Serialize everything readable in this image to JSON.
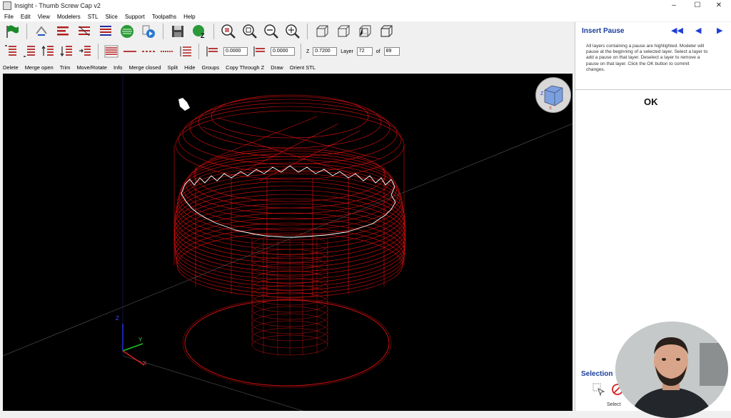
{
  "window": {
    "title": "Insight - Thumb Screw Cap v2"
  },
  "window_controls": {
    "minimize": "–",
    "maximize": "☐",
    "close": "✕"
  },
  "menu": [
    "File",
    "Edit",
    "View",
    "Modelers",
    "STL",
    "Slice",
    "Support",
    "Toolpaths",
    "Help"
  ],
  "toolbar2": {
    "field1": "0.0000",
    "field2": "0.0000",
    "z_label": "Z",
    "z_value": "0.7200",
    "layer_label": "Layer",
    "layer_value": "72",
    "of_label": "of",
    "layer_total": "89"
  },
  "toolbar3": [
    "Delete",
    "Merge open",
    "Trim",
    "Move/Rotate",
    "Info",
    "Merge closed",
    "Split",
    "Hide",
    "Groups",
    "Copy Through Z",
    "Draw",
    "Orient STL"
  ],
  "axes": {
    "z": "Z",
    "y": "Y",
    "x": "X"
  },
  "panel": {
    "title": "Insert Pause",
    "nav_first": "◀◀",
    "nav_prev": "◀",
    "nav_next": "▶",
    "description": "All layers containing a pause are highlighted. Modeler will pause at the beginning of a selected layer. Select a layer to add a pause on that layer. Deselect a layer to remove a pause on that layer. Click the OK button to commit changes.",
    "ok_label": "OK",
    "selection_title": "Selection",
    "select_label": "Select"
  },
  "colors": {
    "accent": "#1a3d9a",
    "model": "#e01010",
    "viewport_bg": "#000000",
    "highlight_layer": "#ffffff"
  }
}
